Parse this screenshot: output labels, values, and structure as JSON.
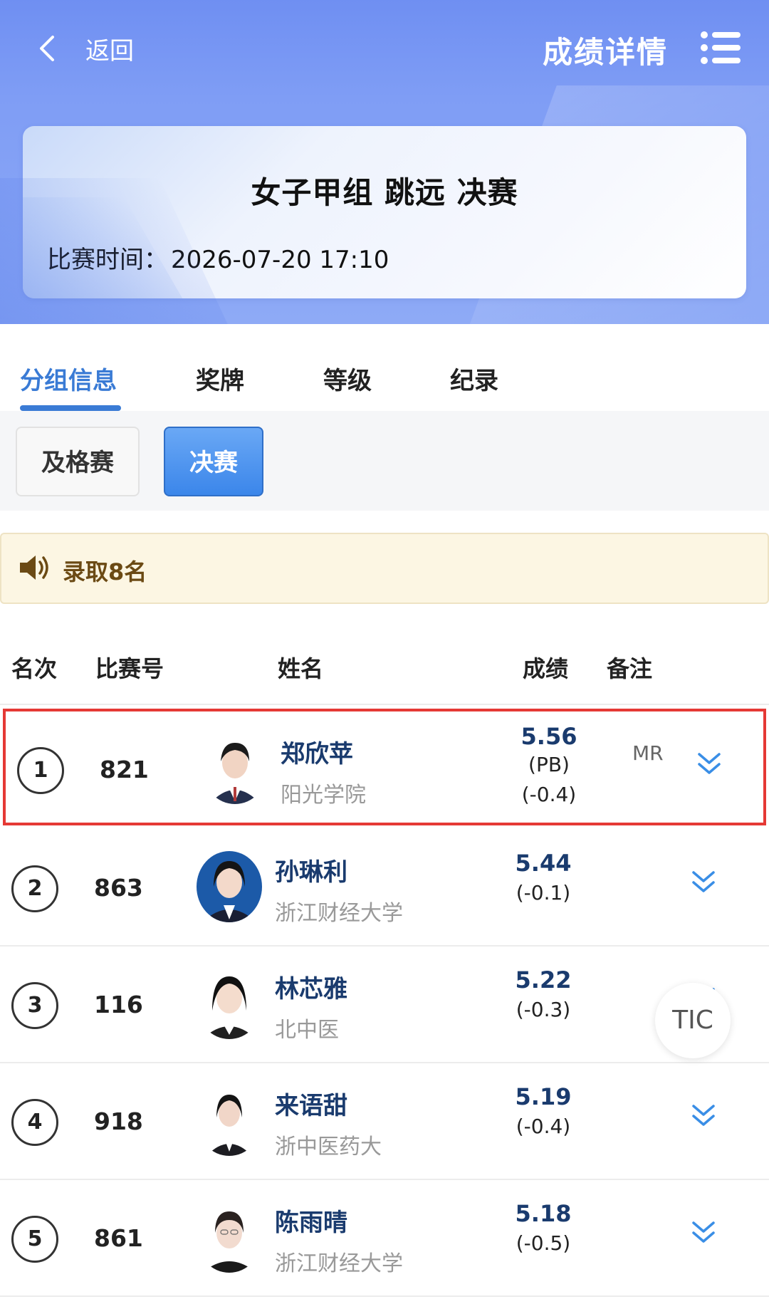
{
  "header": {
    "back_label": "返回",
    "title": "成绩详情"
  },
  "event": {
    "title": "女子甲组 跳远 决赛",
    "time_label": "比赛时间：",
    "time_value": "2026-07-20  17:10"
  },
  "tabs": [
    {
      "label": "分组信息",
      "active": true
    },
    {
      "label": "奖牌",
      "active": false
    },
    {
      "label": "等级",
      "active": false
    },
    {
      "label": "纪录",
      "active": false
    }
  ],
  "subtabs": [
    {
      "label": "及格赛",
      "active": false
    },
    {
      "label": "决赛",
      "active": true
    }
  ],
  "notice": {
    "text": "录取8名"
  },
  "columns": {
    "rank": "名次",
    "bib": "比赛号",
    "name": "姓名",
    "mark": "成绩",
    "remark": "备注"
  },
  "rows": [
    {
      "rank": "1",
      "bib": "821",
      "name": "郑欣苹",
      "school": "阳光学院",
      "mark": "5.56",
      "pb": "(PB)",
      "wind": "(-0.4)",
      "remark": "MR"
    },
    {
      "rank": "2",
      "bib": "863",
      "name": "孙琳利",
      "school": "浙江财经大学",
      "mark": "5.44",
      "wind": "(-0.1)"
    },
    {
      "rank": "3",
      "bib": "116",
      "name": "林芯雅",
      "school": "北中医",
      "mark": "5.22",
      "wind": "(-0.3)"
    },
    {
      "rank": "4",
      "bib": "918",
      "name": "来语甜",
      "school": "浙中医药大",
      "mark": "5.19",
      "wind": "(-0.4)"
    },
    {
      "rank": "5",
      "bib": "861",
      "name": "陈雨晴",
      "school": "浙江财经大学",
      "mark": "5.18",
      "wind": "(-0.5)"
    }
  ],
  "float_button": {
    "label": "TIC"
  },
  "colors": {
    "accent": "#3a7bd5",
    "highlight_border": "#e53935",
    "notice_bg": "#fcf6e3"
  }
}
